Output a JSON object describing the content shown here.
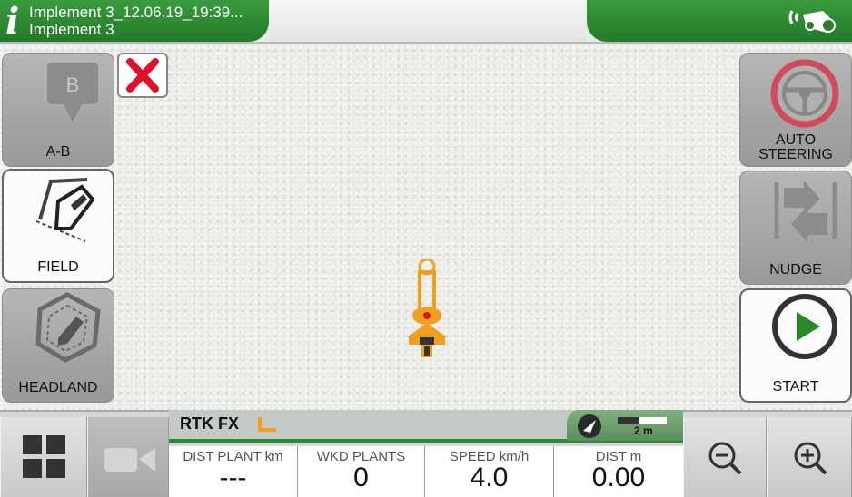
{
  "header": {
    "title_line1": "Implement 3_12.06.19_19:39...",
    "title_line2": "Implement 3",
    "info_icon": "i",
    "brand_color": "#2e8b34"
  },
  "left_panel": {
    "ab_letter": "B",
    "ab_label": "A-B",
    "field_label": "FIELD",
    "headland_label": "HEADLAND"
  },
  "right_panel": {
    "auto_label_1": "AUTO",
    "auto_label_2": "STEERING",
    "nudge_label": "NUDGE",
    "start_label": "START"
  },
  "status": {
    "gps_mode": "RTK FX",
    "scale_label": "2 m"
  },
  "stats": [
    {
      "label": "DIST PLANT km",
      "value": "---"
    },
    {
      "label": "WKD PLANTS",
      "value": "0"
    },
    {
      "label": "SPEED km/h",
      "value": "4.0"
    },
    {
      "label": "DIST m",
      "value": "0.00"
    }
  ],
  "icons": {
    "close": "close-icon",
    "grid": "grid-icon",
    "camera": "camera-icon",
    "zoom_out": "zoom-out-icon",
    "zoom_in": "zoom-in-icon"
  },
  "colors": {
    "accent_orange": "#f0a020",
    "steering_red": "#d04a5a",
    "start_green": "#2a8a2a",
    "close_red": "#e0102a"
  }
}
